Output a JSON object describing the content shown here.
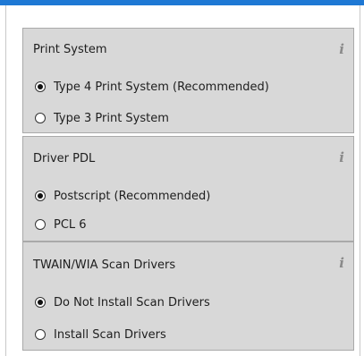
{
  "groups": [
    {
      "title": "Print System",
      "info_icon": "info-icon",
      "options": [
        {
          "label": "Type 4 Print System (Recommended)",
          "checked": true
        },
        {
          "label": "Type 3 Print System",
          "checked": false
        }
      ]
    },
    {
      "title": "Driver PDL",
      "info_icon": "info-icon",
      "options": [
        {
          "label": "Postscript (Recommended)",
          "checked": true
        },
        {
          "label": "PCL 6",
          "checked": false
        }
      ]
    },
    {
      "title": "TWAIN/WIA Scan Drivers",
      "info_icon": "info-icon",
      "options": [
        {
          "label": "Do Not Install Scan Drivers",
          "checked": true
        },
        {
          "label": "Install Scan Drivers",
          "checked": false
        }
      ]
    }
  ],
  "colors": {
    "accent": "#1e78d4",
    "group_background": "#d8d8d8",
    "group_border": "#a9a9a9",
    "info_icon": "#8a8a8a"
  }
}
